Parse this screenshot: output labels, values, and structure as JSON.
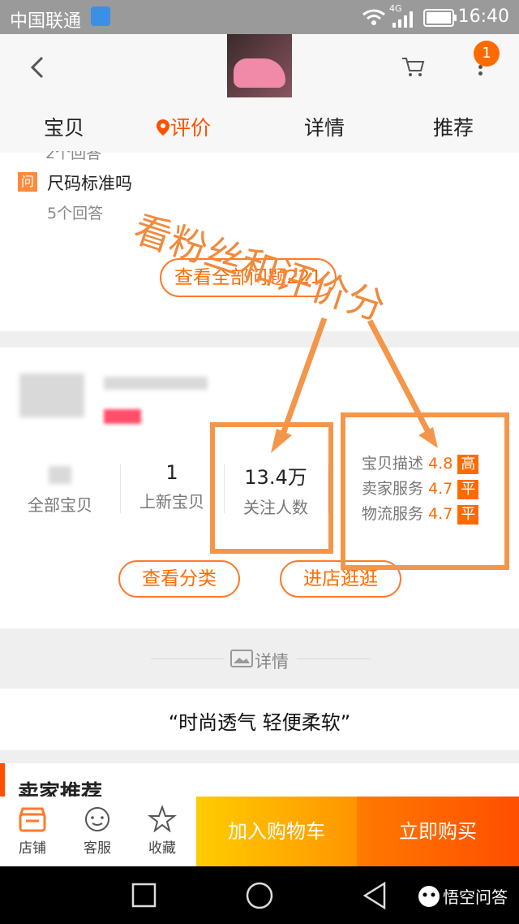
{
  "status": {
    "carrier": "中国联通",
    "network": "4G",
    "time": "16:40"
  },
  "header": {
    "cart_badge": "1"
  },
  "tabs": [
    "宝贝",
    "评价",
    "详情",
    "推荐"
  ],
  "qa": {
    "prev_partial": "2个回答",
    "tag": "问",
    "question": "尺码标准吗",
    "answers": "5个回答",
    "view_all": "查看全部问题221"
  },
  "shop": {
    "stats": [
      {
        "num": "",
        "label": "全部宝贝"
      },
      {
        "num": "1",
        "label": "上新宝贝"
      },
      {
        "num": "13.4万",
        "label": "关注人数"
      }
    ],
    "ratings": [
      {
        "label": "宝贝描述",
        "score": "4.8",
        "level": "高"
      },
      {
        "label": "卖家服务",
        "score": "4.7",
        "level": "平"
      },
      {
        "label": "物流服务",
        "score": "4.7",
        "level": "平"
      }
    ],
    "btn_category": "查看分类",
    "btn_enter": "进店逛逛"
  },
  "details": {
    "divider_label": "详情",
    "slogan": "“时尚透气 轻便柔软”"
  },
  "seller_rec": {
    "title": "卖家推荐"
  },
  "annotation": {
    "text": "看粉丝和评价分"
  },
  "bottom": {
    "shop": "店铺",
    "service": "客服",
    "fav": "收藏",
    "add_cart": "加入购物车",
    "buy_now": "立即购买"
  },
  "watermark": "悟空问答",
  "colors": {
    "accent": "#ff5000",
    "annotation": "#f4964a",
    "cart_gradient": [
      "#ffcc00",
      "#ff9500"
    ],
    "buy_gradient": [
      "#ff7a00",
      "#ff4e00"
    ]
  }
}
